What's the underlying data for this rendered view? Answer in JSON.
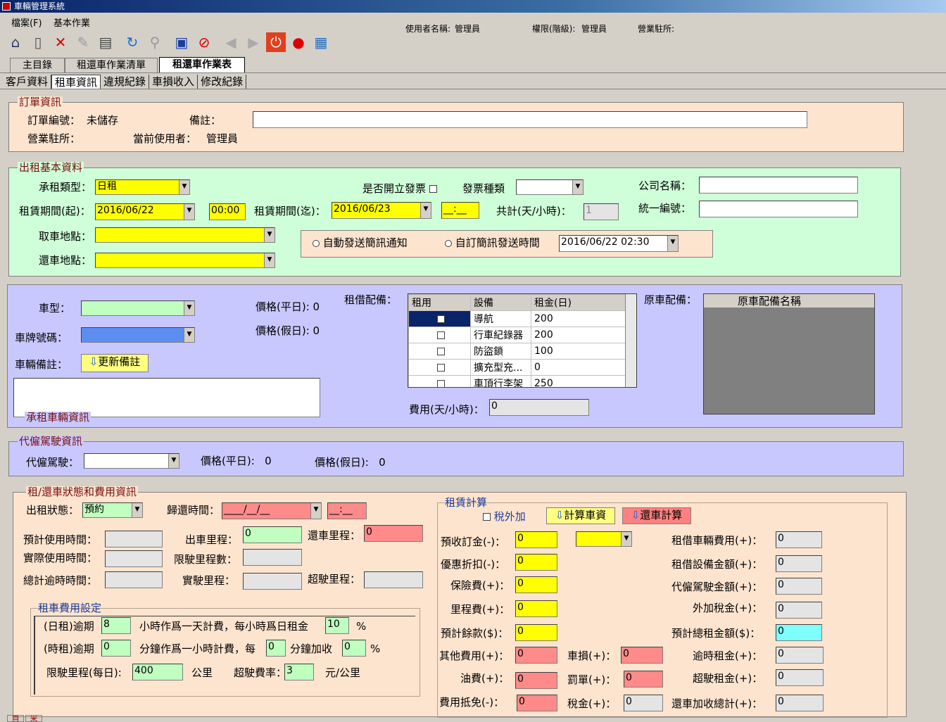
{
  "window": {
    "title": "車輛管理系統"
  },
  "menu": [
    "檔案(F)",
    "基本作業"
  ],
  "userinfo": {
    "user_label": "使用者名稱:",
    "user_value": "管理員",
    "perm_label": "權限(階級):",
    "perm_value": "管理員",
    "store_label": "營業駐所:"
  },
  "toolbar": [
    "home-icon",
    "new-document-icon",
    "delete-icon",
    "edit-pencil-icon",
    "print-icon",
    "refresh-icon",
    "search-icon",
    "save-icon",
    "cancel-icon",
    "back-arrow-icon",
    "forward-arrow-icon",
    "power-icon",
    "alarm-icon",
    "image-icon"
  ],
  "tabs": [
    "主目錄",
    "租還車作業清單",
    "租還車作業表"
  ],
  "subtabs": [
    "客戶資料",
    "租車資訊",
    "違規紀錄",
    "車損收入",
    "修改紀錄"
  ],
  "order": {
    "legend": "訂單資訊",
    "order_no_label": "訂單編號：",
    "order_no_value": "未儲存",
    "note_label": "備註：",
    "store_label": "營業駐所：",
    "user_label": "當前使用者：",
    "user_value": "管理員"
  },
  "rental": {
    "legend": "出租基本資料",
    "type_label": "承租類型：",
    "type_value": "日租",
    "invoice_label": "是否開立發票",
    "invoice_type_label": "發票種類",
    "company_label": "公司名稱：",
    "start_label": "租賃期間(起)：",
    "start_date": "2016/06/22",
    "start_time": "00:00",
    "end_label": "租賃期間(迄)：",
    "end_date": "2016/06/23",
    "end_time": "__:__",
    "total_label": "共計(天/小時)：",
    "total_value": "1",
    "taxid_label": "統一編號：",
    "pickup_label": "取車地點：",
    "return_label": "還車地點：",
    "sms_auto": "自動發送簡訊通知",
    "sms_custom": "自訂簡訊發送時間",
    "sms_time": "2016/06/22 02:30"
  },
  "vehicle": {
    "legend": "承租車輛資訊",
    "type_label": "車型：",
    "plate_label": "車牌號碼：",
    "note_label": "車輛備註：",
    "update_btn": "更新備註",
    "price_weekday_label": "價格(平日):",
    "price_weekday": "0",
    "price_holiday_label": "價格(假日):",
    "price_holiday": "0",
    "equip_label": "租借配備：",
    "equip_headers": [
      "租用",
      "設備",
      "租金(日)"
    ],
    "equip_rows": [
      {
        "name": "導航",
        "price": "200"
      },
      {
        "name": "行車紀錄器",
        "price": "200"
      },
      {
        "name": "防盜鎖",
        "price": "100"
      },
      {
        "name": "擴充型充...",
        "price": "0"
      },
      {
        "name": "車頂行李架",
        "price": "250"
      }
    ],
    "orig_label": "原車配備：",
    "orig_header": "原車配備名稱",
    "fee_label": "費用(天/小時)：",
    "fee_value": "0"
  },
  "driver": {
    "legend": "代僱駕駛資訊",
    "driver_label": "代僱駕駛：",
    "weekday_label": "價格(平日):",
    "weekday_value": "0",
    "holiday_label": "價格(假日):",
    "holiday_value": "0"
  },
  "status": {
    "legend": "租/還車狀態和費用資訊",
    "status_label": "出租狀態：",
    "status_value": "預約",
    "return_time_label": "歸還時間：",
    "return_date": "____/__/__",
    "return_time": "__:__",
    "est_label": "預計使用時間：",
    "actual_label": "實際使用時間：",
    "overtime_label": "總計逾時時間：",
    "out_km_label": "出車里程：",
    "out_km": "0",
    "limit_km_label": "限駛里程數：",
    "real_km_label": "實駛里程：",
    "return_km_label": "還車里程：",
    "return_km": "0",
    "over_km_label": "超駛里程："
  },
  "feeset": {
    "legend": "租車費用設定",
    "day_label": "(日租)逾期",
    "day_value": "8",
    "day_text": "小時作爲一天計費，每小時爲日租金",
    "day_pct": "10",
    "pct": "%",
    "hour_label": "(時租)逾期",
    "hour_value": "0",
    "hour_text": "分鐘作爲一小時計費，每",
    "hour_mins": "0",
    "hour_text2": "分鐘加收",
    "hour_pct": "0",
    "limit_label": "限駛里程(每日):",
    "limit_value": "400",
    "km": "公里",
    "over_label": "超駛費率：",
    "over_value": "3",
    "unit": "元/公里"
  },
  "calc": {
    "legend": "租賃計算",
    "tax_label": "稅外加",
    "calc_btn": "計算車資",
    "return_btn": "還車計算",
    "deposit_label": "預收訂金(-)：",
    "deposit": "0",
    "discount_label": "優惠折扣(-)：",
    "discount": "0",
    "insurance_label": "保險費(+)：",
    "insurance": "0",
    "km_fee_label": "里程費(+)：",
    "km_fee": "0",
    "balance_label": "預計餘款($)：",
    "balance": "0",
    "other_label": "其他費用(+)：",
    "other": "0",
    "damage_label": "車損(+)：",
    "damage": "0",
    "fuel_label": "油費(+)：",
    "fuel": "0",
    "fine_label": "罰單(+)：",
    "fine": "0",
    "offset_label": "費用抵免(-)：",
    "offset": "0",
    "tax2_label": "稅金(+)：",
    "tax2": "0",
    "car_fee_label": "租借車輛費用(+)：",
    "car_fee": "0",
    "equip_fee_label": "租借設備金額(+)：",
    "equip_fee": "0",
    "driver_fee_label": "代僱駕駛金額(+)：",
    "driver_fee": "0",
    "extra_tax_label": "外加稅金(+)：",
    "extra_tax": "0",
    "total_label": "預計總租金額($)：",
    "total": "0",
    "overtime_fee_label": "逾時租金(+)：",
    "overtime_fee": "0",
    "overkm_fee_label": "超駛租金(+)：",
    "overkm_fee": "0",
    "return_extra_label": "還車加收總計(+)：",
    "return_extra": "0"
  },
  "bottom_buttons": [
    "自",
    "米"
  ]
}
